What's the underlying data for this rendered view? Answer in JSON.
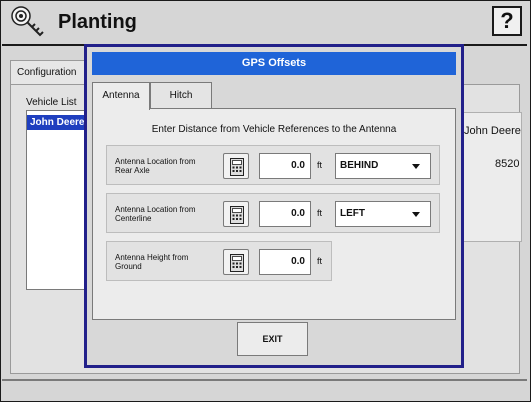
{
  "app": {
    "title": "Planting",
    "help_label": "?"
  },
  "background": {
    "tab_label": "Configuration",
    "vehicle_list_label": "Vehicle List",
    "selected_vehicle": "John Deere",
    "make": "John Deere",
    "model": "8520"
  },
  "dialog": {
    "title": "GPS Offsets",
    "tabs": [
      {
        "label": "Antenna",
        "active": true
      },
      {
        "label": "Hitch",
        "active": false
      }
    ],
    "instruction": "Enter Distance from Vehicle References to the Antenna",
    "rows": [
      {
        "label_line1": "Antenna Location from",
        "label_line2": "Rear Axle",
        "value": "0.0",
        "unit": "ft",
        "selection": "BEHIND"
      },
      {
        "label_line1": "Antenna Location from",
        "label_line2": "Centerline",
        "value": "0.0",
        "unit": "ft",
        "selection": "LEFT"
      },
      {
        "label_line1": "Antenna Height from",
        "label_line2": "Ground",
        "value": "0.0",
        "unit": "ft"
      }
    ],
    "exit_label": "EXIT"
  },
  "icons": {
    "app": "wrench-key-icon",
    "calculator": "calculator-icon",
    "dropdown": "chevron-down-icon"
  },
  "colors": {
    "title_bar": "#1f64d8",
    "dialog_border": "#22208a",
    "selection": "#1f3fbf"
  }
}
